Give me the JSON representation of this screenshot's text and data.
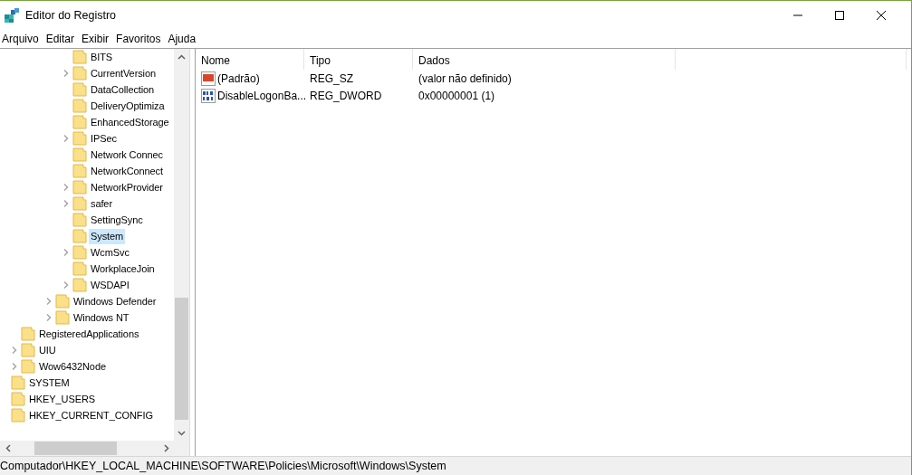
{
  "window": {
    "title": "Editor do Registro"
  },
  "menu": [
    "Arquivo",
    "Editar",
    "Exibir",
    "Favoritos",
    "Ajuda"
  ],
  "tree": [
    {
      "children": [
        {
          "children": [
            {
              "children": [
                {
                  "children": [
                    {
                      "children": [
                        {
                          "label": "BITS",
                          "expandable": false,
                          "selected": false
                        },
                        {
                          "label": "CurrentVersion",
                          "expandable": true,
                          "selected": false
                        },
                        {
                          "label": "DataCollection",
                          "expandable": false,
                          "selected": false
                        },
                        {
                          "label": "DeliveryOptimiza",
                          "expandable": false,
                          "selected": false
                        },
                        {
                          "label": "EnhancedStorage",
                          "expandable": false,
                          "selected": false
                        },
                        {
                          "label": "IPSec",
                          "expandable": true,
                          "selected": false
                        },
                        {
                          "label": "Network Connec",
                          "expandable": false,
                          "selected": false
                        },
                        {
                          "label": "NetworkConnect",
                          "expandable": false,
                          "selected": false
                        },
                        {
                          "label": "NetworkProvider",
                          "expandable": true,
                          "selected": false
                        },
                        {
                          "label": "safer",
                          "expandable": true,
                          "selected": false
                        },
                        {
                          "label": "SettingSync",
                          "expandable": false,
                          "selected": false
                        },
                        {
                          "label": "System",
                          "expandable": false,
                          "selected": true
                        },
                        {
                          "label": "WcmSvc",
                          "expandable": true,
                          "selected": false
                        },
                        {
                          "label": "WorkplaceJoin",
                          "expandable": false,
                          "selected": false
                        },
                        {
                          "label": "WSDAPI",
                          "expandable": true,
                          "selected": false
                        }
                      ]
                    },
                    {
                      "label": "Windows Defender",
                      "expandable": true,
                      "selected": false
                    },
                    {
                      "label": "Windows NT",
                      "expandable": true,
                      "selected": false
                    }
                  ]
                }
              ]
            },
            {
              "label": "RegisteredApplications",
              "expandable": false,
              "selected": false
            },
            {
              "label": "UIU",
              "expandable": true,
              "selected": false
            },
            {
              "label": "Wow6432Node",
              "expandable": true,
              "selected": false
            }
          ]
        },
        {
          "label": "SYSTEM",
          "expandable": false,
          "selected": false
        }
      ]
    },
    {
      "label": "HKEY_USERS",
      "expandable": false,
      "selected": false
    },
    {
      "label": "HKEY_CURRENT_CONFIG",
      "expandable": false,
      "selected": false
    }
  ],
  "table": {
    "columns": [
      "Nome",
      "Tipo",
      "Dados"
    ],
    "rows": [
      {
        "kind": "string",
        "name": "(Padrão)",
        "type": "REG_SZ",
        "data": "(valor não definido)"
      },
      {
        "kind": "binary",
        "name": "DisableLogonBa...",
        "type": "REG_DWORD",
        "data": "0x00000001 (1)"
      }
    ]
  },
  "status_bar": "Computador\\HKEY_LOCAL_MACHINE\\SOFTWARE\\Policies\\Microsoft\\Windows\\System"
}
